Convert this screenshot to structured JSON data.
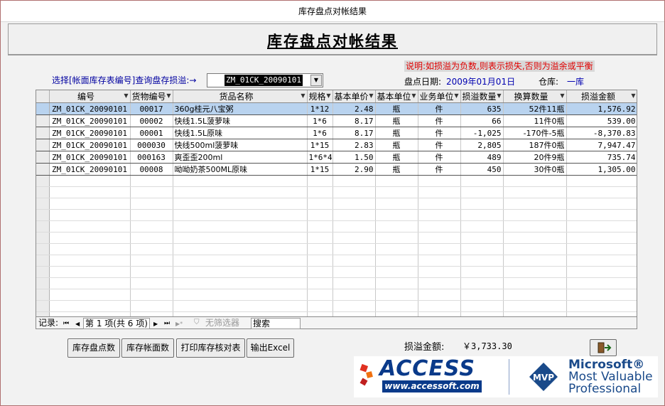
{
  "window": {
    "title": "库存盘点对帐结果"
  },
  "header": {
    "title": "库存盘点对帐结果"
  },
  "note": "说明:如损溢为负数,则表示损失,否则为溢余或平衡",
  "selector": {
    "label": "选择[帐面库存表编号]查询盘存损溢:→",
    "value": "ZM_01CK_20090101"
  },
  "date": {
    "label": "盘点日期:",
    "value": "2009年01月01日"
  },
  "warehouse": {
    "label": "仓库:",
    "value": "一库"
  },
  "grid": {
    "columns": [
      "编号",
      "货物编号",
      "货品名称",
      "规格",
      "基本单价",
      "基本单位",
      "业务单位",
      "损溢数量",
      "换算数量",
      "损溢金额"
    ],
    "rows": [
      [
        "ZM_01CK_20090101",
        "00017",
        "360g桂元八宝粥",
        "1*12",
        "2.48",
        "瓶",
        "件",
        "635",
        "52件11瓶",
        "1,576.92"
      ],
      [
        "ZM_01CK_20090101",
        "00002",
        "快线1.5L菠萝味",
        "1*6",
        "8.17",
        "瓶",
        "件",
        "66",
        "11件0瓶",
        "539.00"
      ],
      [
        "ZM_01CK_20090101",
        "00001",
        "快线1.5L原味",
        "1*6",
        "8.17",
        "瓶",
        "件",
        "-1,025",
        "-170件-5瓶",
        "-8,370.83"
      ],
      [
        "ZM_01CK_20090101",
        "000030",
        "快线500ml菠萝味",
        "1*15",
        "2.83",
        "瓶",
        "件",
        "2,805",
        "187件0瓶",
        "7,947.47"
      ],
      [
        "ZM_01CK_20090101",
        "000163",
        "爽歪歪200ml",
        "1*6*4",
        "1.50",
        "瓶",
        "件",
        "489",
        "20件9瓶",
        "735.74"
      ],
      [
        "ZM_01CK_20090101",
        "00008",
        "呦呦奶茶500ML原味",
        "1*15",
        "2.90",
        "瓶",
        "件",
        "450",
        "30件0瓶",
        "1,305.00"
      ]
    ]
  },
  "navigator": {
    "record_label": "记录:",
    "first": "⏮",
    "prev": "◀",
    "page": "第 1 项(共 6 项)",
    "next": "▶",
    "last": "⏭",
    "new": "▶*",
    "filter": "无筛选器",
    "search": "搜索"
  },
  "buttons": {
    "stock_count": "库存盘点数",
    "stock_book": "库存帐面数",
    "print": "打印库存核对表",
    "export": "输出Excel"
  },
  "total": {
    "label": "损溢金额:",
    "value": "￥3,733.30"
  },
  "banner": {
    "access": "ACCESS",
    "url": "www.accessoft.com",
    "mvp": "MVP",
    "ms_line1": "Microsoft®",
    "ms_line2": "Most Valuable",
    "ms_line3": "Professional"
  },
  "colors": {
    "note_text": "#e00000",
    "selected_row": "#b9d3ef",
    "brand_blue": "#0a3a8a"
  }
}
